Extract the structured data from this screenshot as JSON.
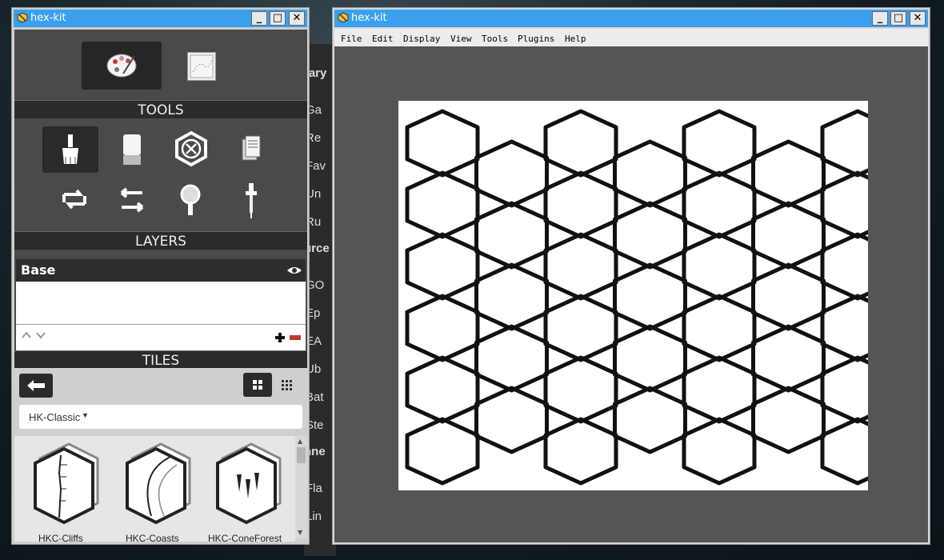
{
  "left_panel": {
    "title": "hex-kit",
    "window_buttons": {
      "minimize": "_",
      "maximize": "□",
      "close": "✕"
    },
    "top_modes": [
      {
        "name": "palette-icon",
        "selected": true
      },
      {
        "name": "map-icon",
        "selected": false
      }
    ],
    "tools_header": "TOOLS",
    "tools": [
      {
        "name": "brush-icon",
        "selected": true
      },
      {
        "name": "eraser-icon",
        "selected": false
      },
      {
        "name": "clear-hex-icon",
        "selected": false
      },
      {
        "name": "notes-icon",
        "selected": false
      },
      {
        "name": "rotate-icon",
        "selected": false
      },
      {
        "name": "swap-icon",
        "selected": false
      },
      {
        "name": "magnifier-icon",
        "selected": false
      },
      {
        "name": "eyedropper-icon",
        "selected": false
      }
    ],
    "layers_header": "LAYERS",
    "layer_name": "Base",
    "tiles_header": "TILES",
    "tileset_select": "HK-Classic",
    "tiles": [
      {
        "label": "HKC-Cliffs",
        "icon": "cliffs-tile-icon"
      },
      {
        "label": "HKC-Coasts",
        "icon": "coasts-tile-icon"
      },
      {
        "label": "HKC-ConeForest",
        "icon": "cone-forest-tile-icon"
      }
    ]
  },
  "background_window": {
    "items": [
      {
        "text": "rary",
        "bold": true
      },
      {
        "text": "Ga",
        "bold": false
      },
      {
        "text": "Re",
        "bold": false
      },
      {
        "text": "Fav",
        "bold": false
      },
      {
        "text": "Un",
        "bold": false
      },
      {
        "text": "Ru",
        "bold": false
      },
      {
        "text": "urce",
        "bold": true
      },
      {
        "text": "GO",
        "bold": false
      },
      {
        "text": "Ep",
        "bold": false
      },
      {
        "text": "EA",
        "bold": false
      },
      {
        "text": "Ub",
        "bold": false
      },
      {
        "text": "Bat",
        "bold": false
      },
      {
        "text": "Ste",
        "bold": false
      },
      {
        "text": "nne",
        "bold": true
      },
      {
        "text": "Fla",
        "bold": false
      },
      {
        "text": "Lin",
        "bold": false
      }
    ]
  },
  "main_window": {
    "title": "hex-kit",
    "menu": [
      "File",
      "Edit",
      "Display",
      "View",
      "Tools",
      "Plugins",
      "Help"
    ]
  },
  "colors": {
    "titlebar": "#3aa0ee",
    "panel_dark": "#2b2b2b",
    "canvas_bg": "#555555"
  }
}
